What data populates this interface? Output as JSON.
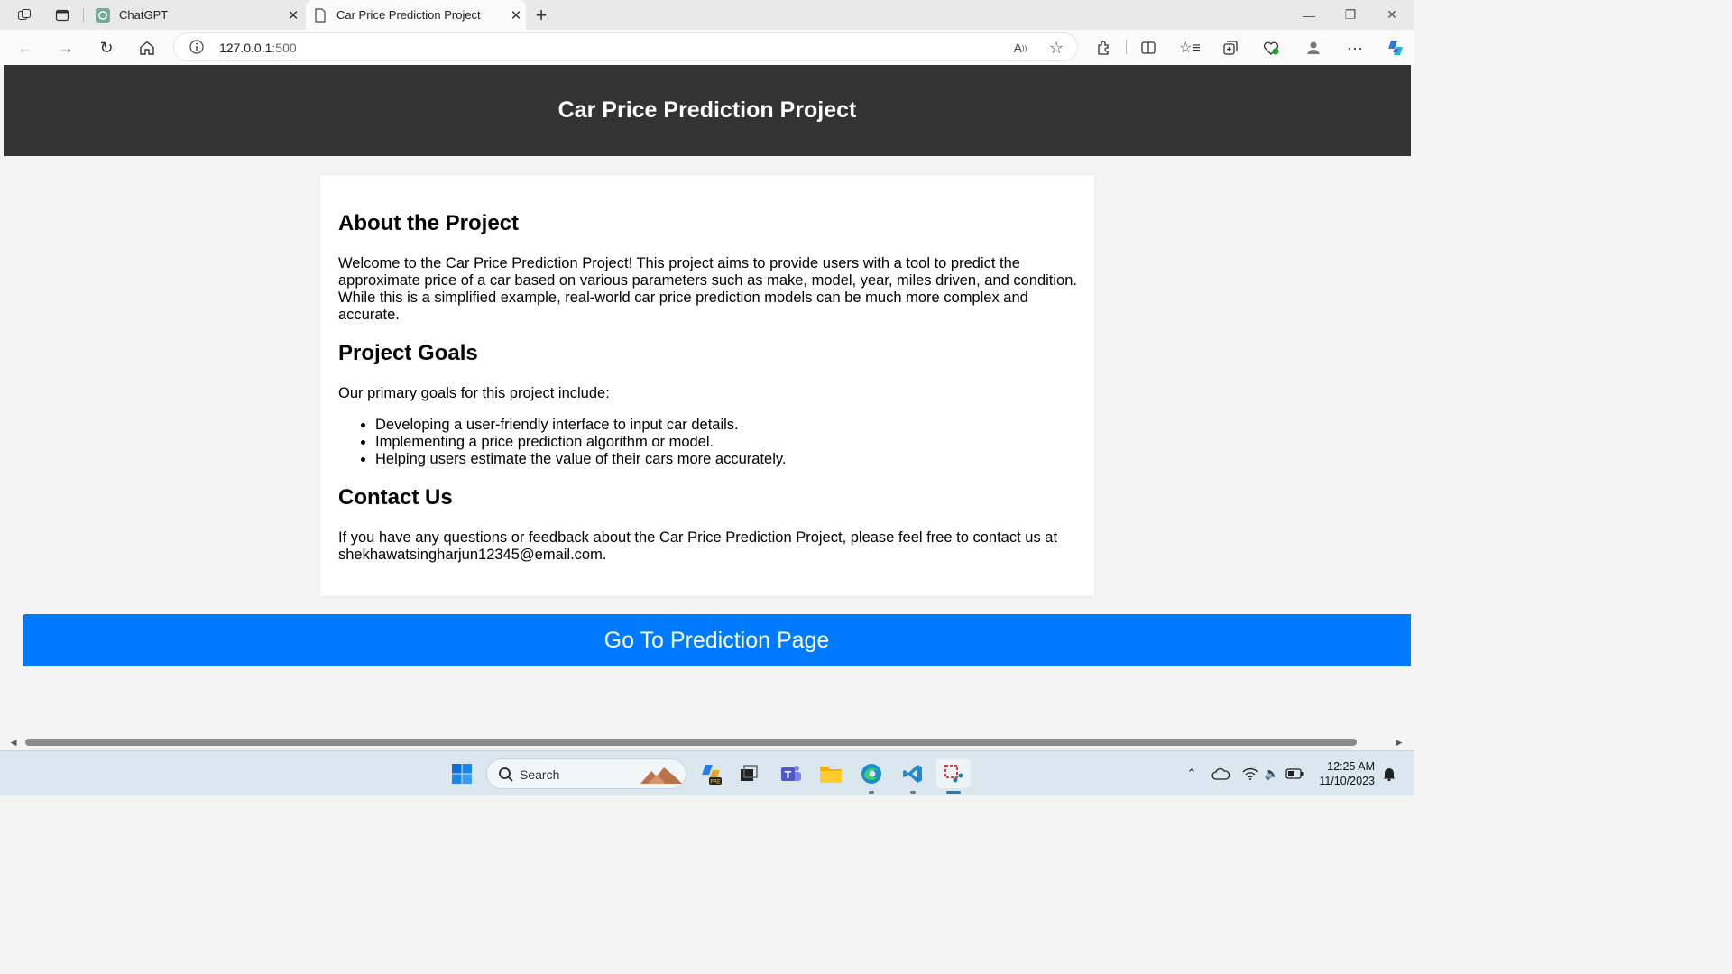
{
  "browser": {
    "tabs": [
      {
        "label": "ChatGPT",
        "active": false
      },
      {
        "label": "Car Price Prediction Project",
        "active": true
      }
    ],
    "address": {
      "host": "127.0.0.1",
      "port": ":500"
    }
  },
  "page": {
    "header_title": "Car Price Prediction Project",
    "about": {
      "heading": "About the Project",
      "text": "Welcome to the Car Price Prediction Project! This project aims to provide users with a tool to predict the approximate price of a car based on various parameters such as make, model, year, miles driven, and condition. While this is a simplified example, real-world car price prediction models can be much more complex and accurate."
    },
    "goals": {
      "heading": "Project Goals",
      "intro": "Our primary goals for this project include:",
      "items": [
        "Developing a user-friendly interface to input car details.",
        "Implementing a price prediction algorithm or model.",
        "Helping users estimate the value of their cars more accurately."
      ]
    },
    "contact": {
      "heading": "Contact Us",
      "text": "If you have any questions or feedback about the Car Price Prediction Project, please feel free to contact us at shekhawatsingharjun12345@email.com."
    },
    "prediction_button": "Go To Prediction Page"
  },
  "taskbar": {
    "search_label": "Search",
    "time": "12:25 AM",
    "date": "11/10/2023"
  },
  "colors": {
    "header_bg": "#333333",
    "button_bg": "#007bff",
    "page_bg": "#f4f4f4"
  }
}
